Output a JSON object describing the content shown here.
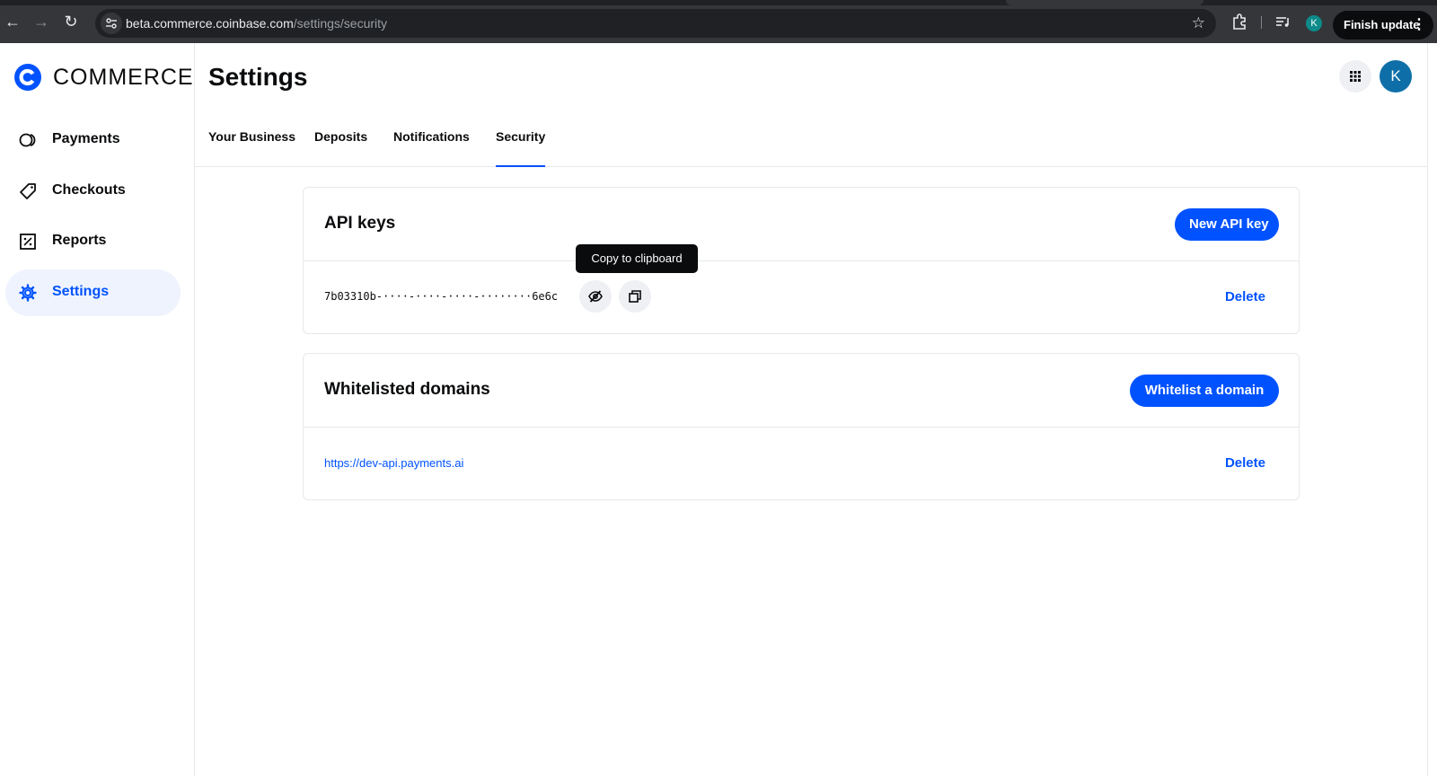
{
  "browser": {
    "url_host": "beta.commerce.coinbase.com",
    "url_path": "/settings/security",
    "profile_initial": "K",
    "finish_update_label": "Finish update",
    "icons": [
      "back-arrow-icon",
      "forward-arrow-icon",
      "reload-icon",
      "site-settings-icon",
      "star-icon",
      "extensions-icon",
      "media-controls-icon",
      "more-vert-icon"
    ]
  },
  "sidebar": {
    "brand": "COMMERCE",
    "brand_color": "#0052ff",
    "items": [
      {
        "label": "Payments",
        "icon": "payments-icon",
        "active": false
      },
      {
        "label": "Checkouts",
        "icon": "tag-icon",
        "active": false
      },
      {
        "label": "Reports",
        "icon": "reports-icon",
        "active": false
      },
      {
        "label": "Settings",
        "icon": "gear-icon",
        "active": true
      }
    ]
  },
  "header": {
    "title": "Settings",
    "user_initial": "K"
  },
  "tabs": [
    {
      "label": "Your Business",
      "active": false
    },
    {
      "label": "Deposits",
      "active": false
    },
    {
      "label": "Notifications",
      "active": false
    },
    {
      "label": "Security",
      "active": true
    }
  ],
  "api_keys": {
    "title": "API keys",
    "new_button": "New API key",
    "key_masked": "7b03310b-····-····-····-········6e6c",
    "tooltip": "Copy to clipboard",
    "delete_label": "Delete"
  },
  "whitelisted_domains": {
    "title": "Whitelisted domains",
    "add_button": "Whitelist a domain",
    "domains": [
      {
        "url": "https://dev-api.payments.ai",
        "delete_label": "Delete"
      }
    ]
  }
}
